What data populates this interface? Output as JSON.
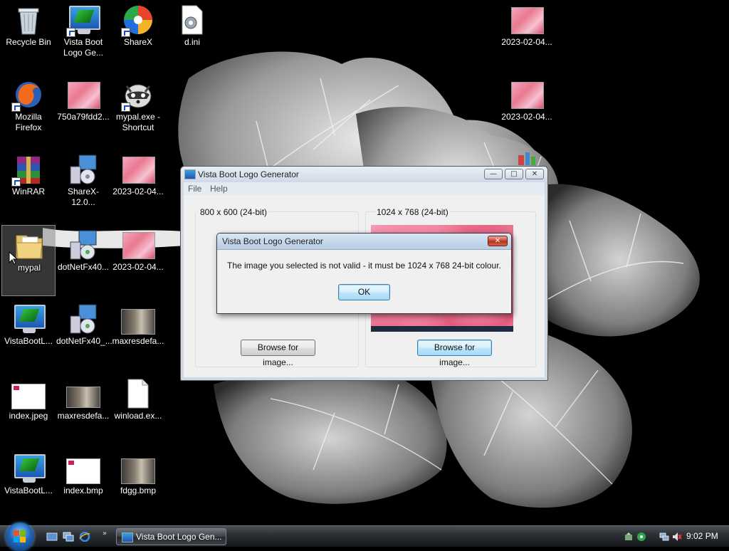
{
  "desktop": {
    "icons": [
      {
        "label": "Recycle Bin"
      },
      {
        "label": "Vista Boot Logo Ge..."
      },
      {
        "label": "ShareX"
      },
      {
        "label": "d.ini"
      },
      {
        "label": "2023-02-04..."
      },
      {
        "label": "Mozilla Firefox"
      },
      {
        "label": "750a79fdd2..."
      },
      {
        "label": "mypal.exe - Shortcut"
      },
      {
        "label": "2023-02-04..."
      },
      {
        "label": "WinRAR"
      },
      {
        "label": "ShareX-12.0..."
      },
      {
        "label": "2023-02-04..."
      },
      {
        "label": "mypal"
      },
      {
        "label": "dotNetFx40..."
      },
      {
        "label": "2023-02-04..."
      },
      {
        "label": "VistaBootL..."
      },
      {
        "label": "dotNetFx40_..."
      },
      {
        "label": "maxresdefa..."
      },
      {
        "label": "index.jpeg"
      },
      {
        "label": "maxresdefa..."
      },
      {
        "label": "winload.ex..."
      },
      {
        "label": "VistaBootL..."
      },
      {
        "label": "index.bmp"
      },
      {
        "label": "fdgg.bmp"
      }
    ]
  },
  "main_window": {
    "title": "Vista Boot Logo Generator",
    "menu": [
      "File",
      "Help"
    ],
    "left_group_label": "800 x 600 (24-bit)",
    "right_group_label": "1024 x 768 (24-bit)",
    "browse_left": "Browse for image...",
    "browse_right": "Browse for image..."
  },
  "dialog": {
    "title": "Vista Boot Logo Generator",
    "message": "The image you selected is not valid - it must be 1024 x 768 24-bit colour.",
    "ok_label": "OK"
  },
  "taskbar": {
    "task_label": "Vista Boot Logo Gen...",
    "clock": "9:02 PM"
  },
  "colors": {
    "accent": "#3c7fb1",
    "close_red": "#c9452f"
  }
}
